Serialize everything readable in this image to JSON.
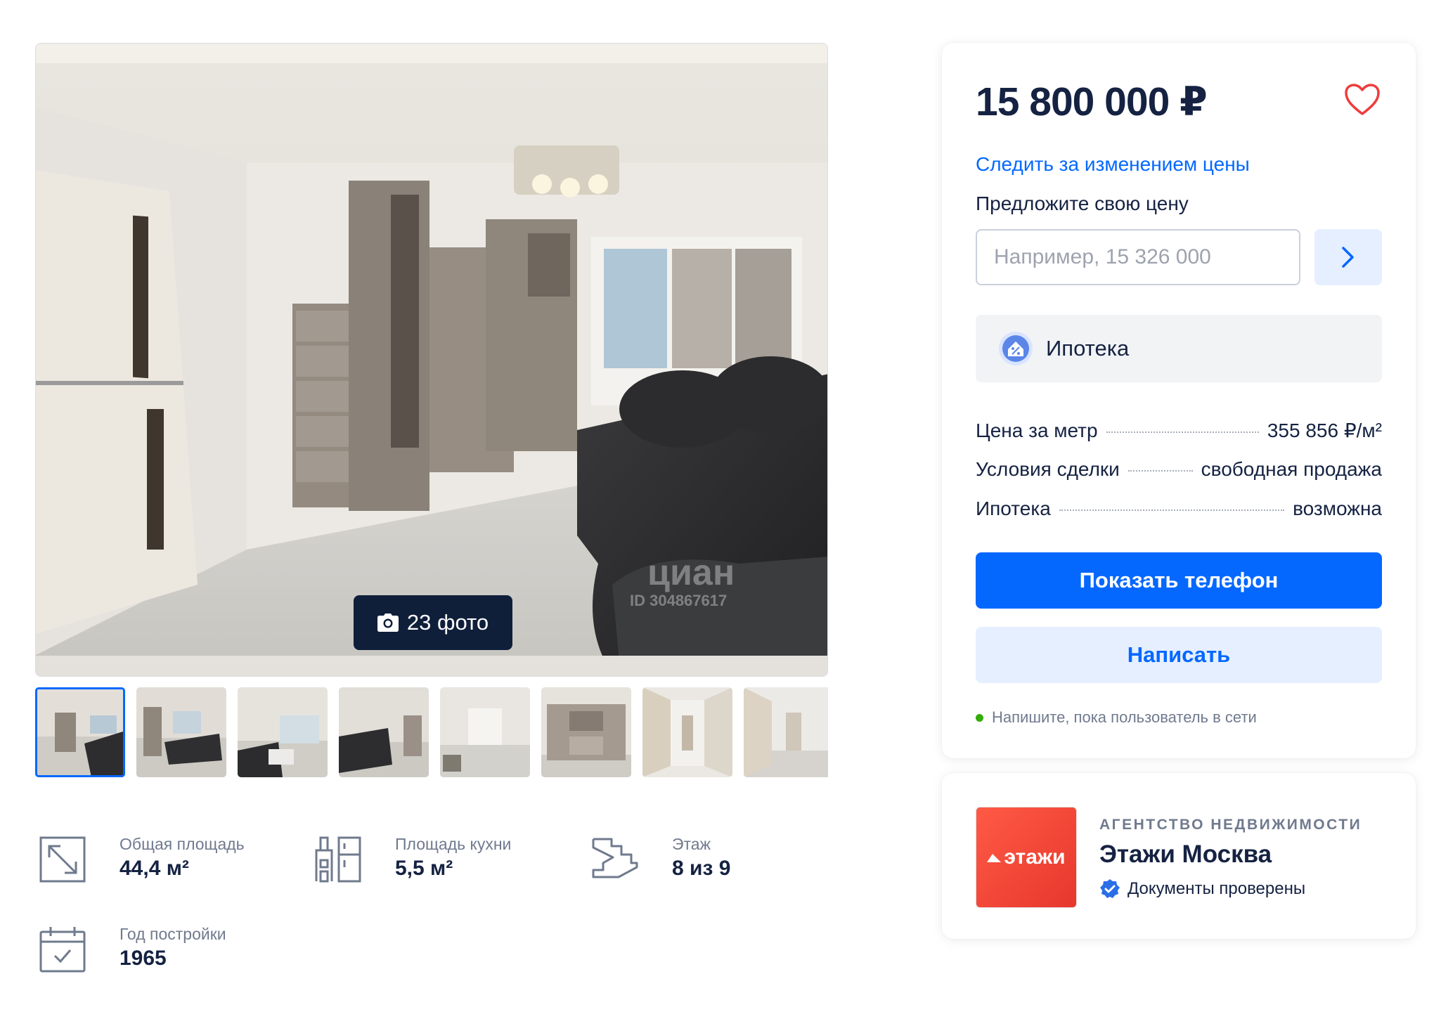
{
  "gallery": {
    "photo_count_label": "23 фото",
    "thumbnails": [
      "photo-1",
      "photo-2",
      "photo-3",
      "photo-4",
      "photo-5",
      "photo-6",
      "photo-7",
      "photo-8"
    ],
    "watermark_brand": "циан",
    "watermark_id": "ID 304867617"
  },
  "features": [
    {
      "icon": "area-icon",
      "label": "Общая площадь",
      "value": "44,4 м²"
    },
    {
      "icon": "kitchen-icon",
      "label": "Площадь кухни",
      "value": "5,5 м²"
    },
    {
      "icon": "stairs-icon",
      "label": "Этаж",
      "value": "8 из 9"
    },
    {
      "icon": "calendar-icon",
      "label": "Год постройки",
      "value": "1965"
    }
  ],
  "price_card": {
    "price": "15 800 000 ₽",
    "follow_label": "Следить за изменением цены",
    "offer_label": "Предложите свою цену",
    "offer_placeholder": "Например, 15 326 000",
    "ipoteka_label": "Ипотека",
    "details": [
      {
        "key": "Цена за метр",
        "value": "355 856 ₽/м²"
      },
      {
        "key": "Условия сделки",
        "value": "свободная продажа"
      },
      {
        "key": "Ипотека",
        "value": "возможна"
      }
    ],
    "show_phone_label": "Показать телефон",
    "write_label": "Написать",
    "online_hint": "Напишите, пока пользователь в сети"
  },
  "agency": {
    "logo_text": "этажи",
    "type": "АГЕНТСТВО НЕДВИЖИМОСТИ",
    "name": "Этажи Москва",
    "verified": "Документы проверены"
  },
  "colors": {
    "accent": "#0468ff",
    "accent_light": "#e6efff",
    "text": "#152242",
    "muted": "#707a8e",
    "heart": "#ef3c3c",
    "logo": "#e7372d"
  }
}
